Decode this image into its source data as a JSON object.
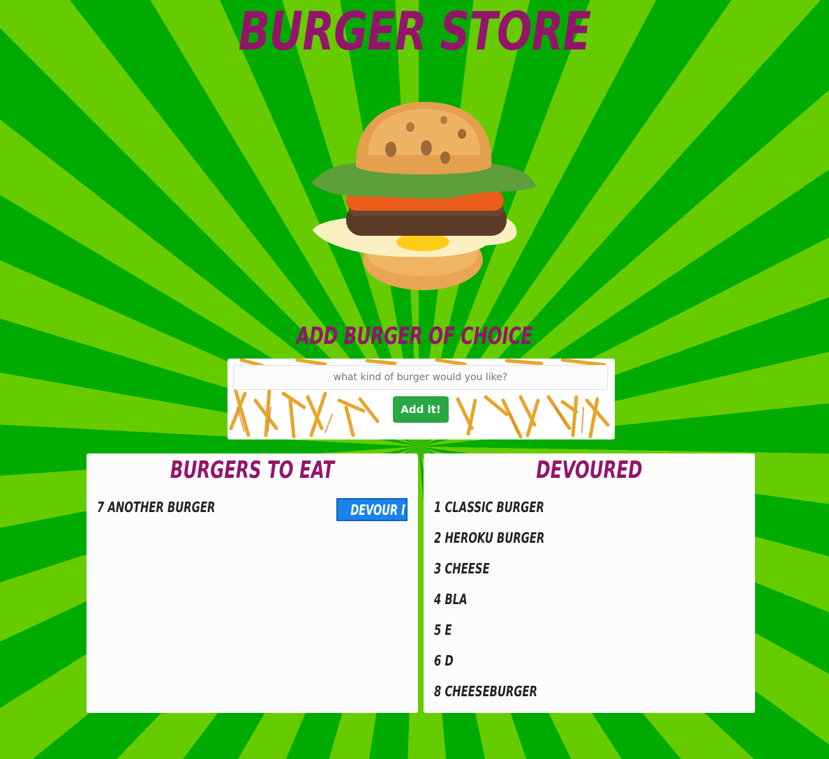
{
  "title": "Burger Store",
  "subtitle": "Add Burger of Choice",
  "form": {
    "placeholder": "what kind of burger would you like?",
    "value": "",
    "add_button_label": "Add it!"
  },
  "to_eat": {
    "heading": "Burgers to Eat",
    "items": [
      {
        "label": "7 Another Burger",
        "button_label": "Devour it!"
      }
    ]
  },
  "devoured": {
    "heading": "Devoured",
    "items": [
      {
        "label": "1 Classic Burger"
      },
      {
        "label": "2 Heroku Burger"
      },
      {
        "label": "3 cheese"
      },
      {
        "label": "4 bla"
      },
      {
        "label": "5 e"
      },
      {
        "label": "6 d"
      },
      {
        "label": "8 cheeseburger"
      }
    ]
  },
  "colors": {
    "heading": "#94146b",
    "ray_dark": "#00ab00",
    "ray_light": "#66cc00",
    "add_button": "#28a745",
    "devour_button": "#1a82e8"
  },
  "icons": {
    "hero": "burger-illustration"
  }
}
